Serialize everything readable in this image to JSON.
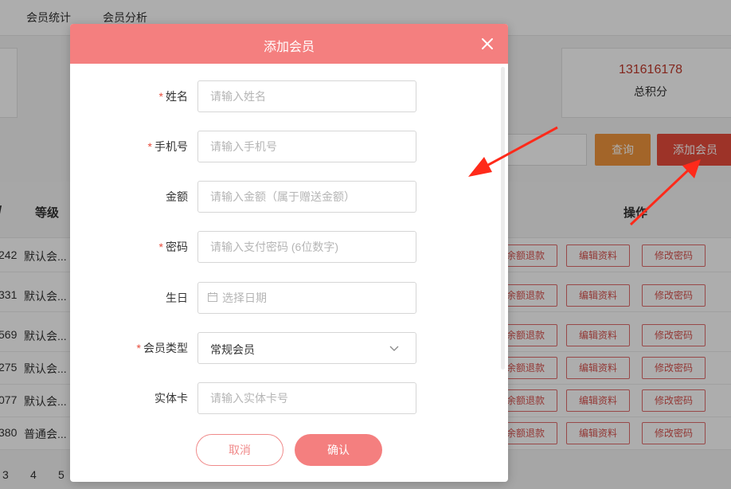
{
  "tabs": [
    "会员统计",
    "会员分析"
  ],
  "stats": {
    "total_points_value": "131616178",
    "total_points_label": "总积分"
  },
  "toolbar": {
    "query_label": "查询",
    "add_member_label": "添加会员"
  },
  "table": {
    "headers": {
      "id_partial": "/",
      "level": "等级",
      "actions": "操作"
    },
    "rows": [
      {
        "id": "242",
        "level": "默认会..."
      },
      {
        "id": "331",
        "level": "默认会..."
      },
      {
        "id": "569",
        "level": "默认会..."
      },
      {
        "id": "275",
        "level": "默认会..."
      },
      {
        "id": "077",
        "level": "默认会..."
      },
      {
        "id": "380",
        "level": "普通会..."
      }
    ],
    "row_actions": {
      "refund": "余额退款",
      "edit": "编辑资料",
      "change_password": "修改密码"
    }
  },
  "pagination": [
    "3",
    "4",
    "5"
  ],
  "modal": {
    "title": "添加会员",
    "fields": {
      "name": {
        "label": "姓名",
        "placeholder": "请输入姓名"
      },
      "phone": {
        "label": "手机号",
        "placeholder": "请输入手机号"
      },
      "amount": {
        "label": "金额",
        "placeholder": "请输入金额（属于赠送金额）"
      },
      "password": {
        "label": "密码",
        "placeholder": "请输入支付密码 (6位数字)"
      },
      "birthday": {
        "label": "生日",
        "placeholder": "选择日期"
      },
      "member_type": {
        "label": "会员类型",
        "value": "常规会员"
      },
      "card": {
        "label": "实体卡",
        "placeholder": "请输入实体卡号"
      }
    },
    "required_mark": "*",
    "cancel_label": "取消",
    "confirm_label": "确认"
  },
  "colors": {
    "modal_header": "#f47f7f",
    "primary": "#e74c3c",
    "query": "#f0963d",
    "annotation_arrow": "#ff2a1a"
  }
}
